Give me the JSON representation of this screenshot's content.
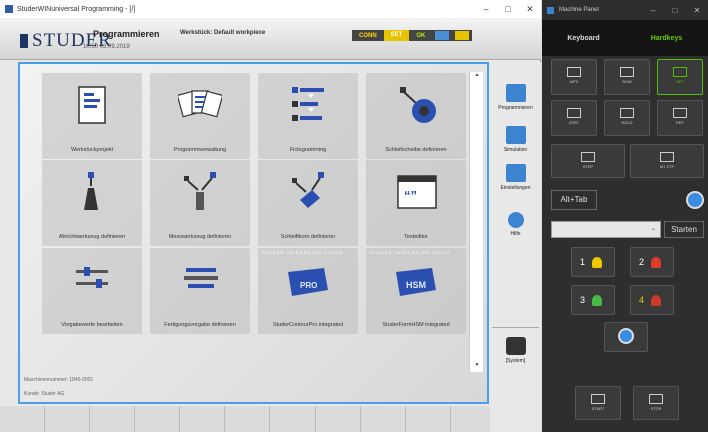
{
  "main_window": {
    "title": "StuderWINuniversal Programming - [/]",
    "controls": [
      "–",
      "□",
      "✕"
    ]
  },
  "header": {
    "logo": "STUDER",
    "mode": "Programmieren",
    "datetime": "10:50 03.09.2019",
    "workpiece": "Werkstück: Default workpiece",
    "status": {
      "conn": "CONN",
      "set": "SET",
      "ok": "OK"
    }
  },
  "tiles": [
    {
      "label": "Werkstückprojekt",
      "icon": "document-icon"
    },
    {
      "label": "Programmverwaltung",
      "icon": "documents-icon"
    },
    {
      "label": "Fictogramming",
      "icon": "fictogramming-icon"
    },
    {
      "label": "Schleifscheibe definieren",
      "icon": "grinding-wheel-icon"
    },
    {
      "label": "Abrichtwerkzeug definieren",
      "icon": "dressing-tool-icon"
    },
    {
      "label": "Messwerkzeug definieren",
      "icon": "measuring-tool-icon"
    },
    {
      "label": "Schleiftkorn definieren",
      "icon": "grain-icon"
    },
    {
      "label": "Texteditor",
      "icon": "text-editor-icon"
    },
    {
      "label": "Vorgabewerte bearbeiten",
      "icon": "sliders-icon"
    },
    {
      "label": "Fertigungsvorgabe definieren",
      "icon": "production-icon"
    },
    {
      "label": "StuderContourPro integrated",
      "icon": "contourpro-icon",
      "tag": "STUDER INTEGRATED TOOLS",
      "badge": "PRO"
    },
    {
      "label": "StuderFormHSM integrated",
      "icon": "formhsm-icon",
      "tag": "STUDER INTEGRATED TOOLS",
      "badge": "HSM"
    }
  ],
  "info": {
    "machine_no": "Maschinennummer: 1845-0001",
    "customer": "Kunde: Studer AG"
  },
  "nav": [
    {
      "label": "Programmieren",
      "icon": "program-icon"
    },
    {
      "label": "Simulation",
      "icon": "simulation-icon"
    },
    {
      "label": "Einstellungen",
      "icon": "settings-icon"
    },
    {
      "label": "Hilfe",
      "icon": "help-icon"
    },
    {
      "label": "[System]",
      "icon": "system-icon"
    }
  ],
  "machine_panel": {
    "title": "Machine Panel",
    "controls": [
      "–",
      "□",
      "✕"
    ],
    "tabs": {
      "keyboard": "Keyboard",
      "hardkeys": "Hardkeys"
    },
    "buttons": [
      "MPX",
      "NCM",
      "SET",
      "ZSST",
      "HOLD",
      "REF",
      "STEP",
      "M1 STP"
    ],
    "alt_tab": "Alt+Tab",
    "starten": "Starten",
    "dropdown_arrow": "⌄",
    "operators": [
      "1",
      "2",
      "3",
      "4"
    ],
    "start": "START",
    "stop": "STOP",
    "colors": {
      "tab_active": "#68c800",
      "panel_bg": "#2e2e2e"
    }
  }
}
